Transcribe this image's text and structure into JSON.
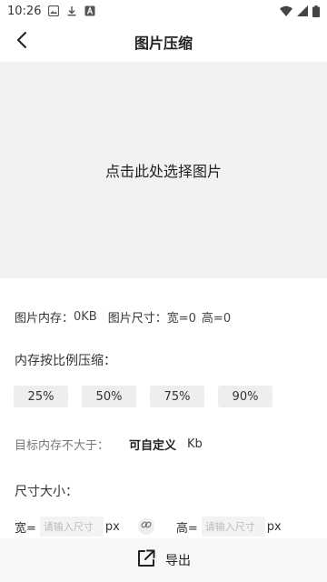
{
  "status_bar": {
    "time": "10:26",
    "icons_left": [
      "image-icon",
      "download-icon",
      "a-icon"
    ],
    "icons_right": [
      "wifi-icon",
      "signal-icon",
      "battery-icon"
    ]
  },
  "header": {
    "title": "图片压缩",
    "back_icon": "chevron-left-icon"
  },
  "image_area": {
    "prompt": "点击此处选择图片"
  },
  "info": {
    "memory_label": "图片内存：",
    "memory_value": "0KB",
    "size_label": "图片尺寸：",
    "width_value": "宽=0",
    "height_value": "高=0"
  },
  "ratio": {
    "label": "内存按比例压缩：",
    "options": [
      "25%",
      "50%",
      "75%",
      "90%"
    ]
  },
  "target": {
    "label": "目标内存不大于：",
    "value": "可自定义",
    "unit": "Kb"
  },
  "dimensions": {
    "label": "尺寸大小：",
    "width_label": "宽=",
    "width_placeholder": "请输入尺寸",
    "width_unit": "px",
    "link_icon": "link-icon",
    "height_label": "高=",
    "height_placeholder": "请输入尺寸",
    "height_unit": "px"
  },
  "export": {
    "label": "导出",
    "icon": "export-icon"
  },
  "colors": {
    "image_area_bg": "#f2f2f2",
    "chip_bg": "#eeeeee",
    "bottom_bar_bg": "#f7f7f7"
  }
}
